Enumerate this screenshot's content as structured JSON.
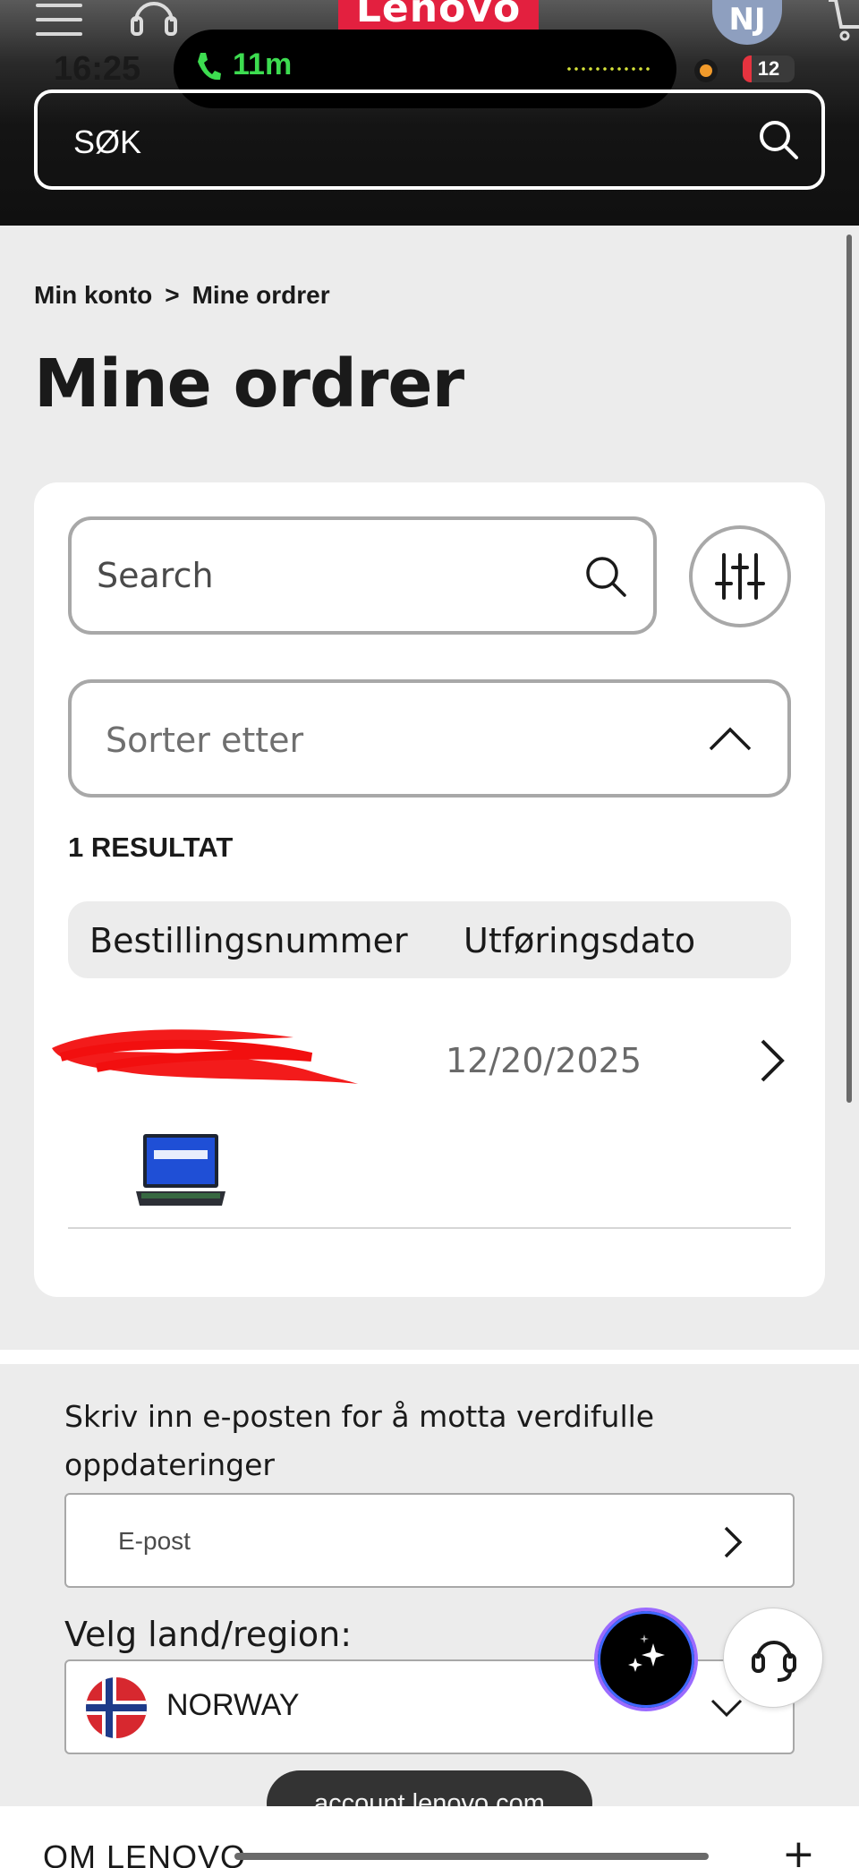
{
  "status_bar": {
    "time": "16:25",
    "call_duration": "11m",
    "battery": "12"
  },
  "header": {
    "logo_text": "Lenovo",
    "avatar_initials": "NJ",
    "search_label": "SØK"
  },
  "breadcrumb": {
    "parent": "Min konto",
    "separator": ">",
    "current": "Mine ordrer"
  },
  "page_title": "Mine ordrer",
  "orders_panel": {
    "search_placeholder": "Search",
    "sort_placeholder": "Sorter etter",
    "result_count": "1 RESULTAT",
    "columns": [
      "Bestillingsnummer",
      "Utføringsdato"
    ],
    "rows": [
      {
        "order_number": "",
        "date": "12/20/2025",
        "thumbnail_icon": "laptop-thumbnail"
      }
    ]
  },
  "newsletter": {
    "text": "Skriv inn e-posten for å motta verdifulle oppdateringer",
    "email_placeholder": "E-post"
  },
  "region": {
    "label": "Velg land/region:",
    "selected": "NORWAY",
    "flag_icon": "norway-flag-icon"
  },
  "browser": {
    "url": "account.lenovo.com"
  },
  "footer": {
    "section_title": "OM LENOVO",
    "expand_symbol": "+"
  },
  "colors": {
    "brand_red": "#e3203f",
    "call_green": "#3ddc50",
    "ai_ring": "#9b6bff"
  }
}
